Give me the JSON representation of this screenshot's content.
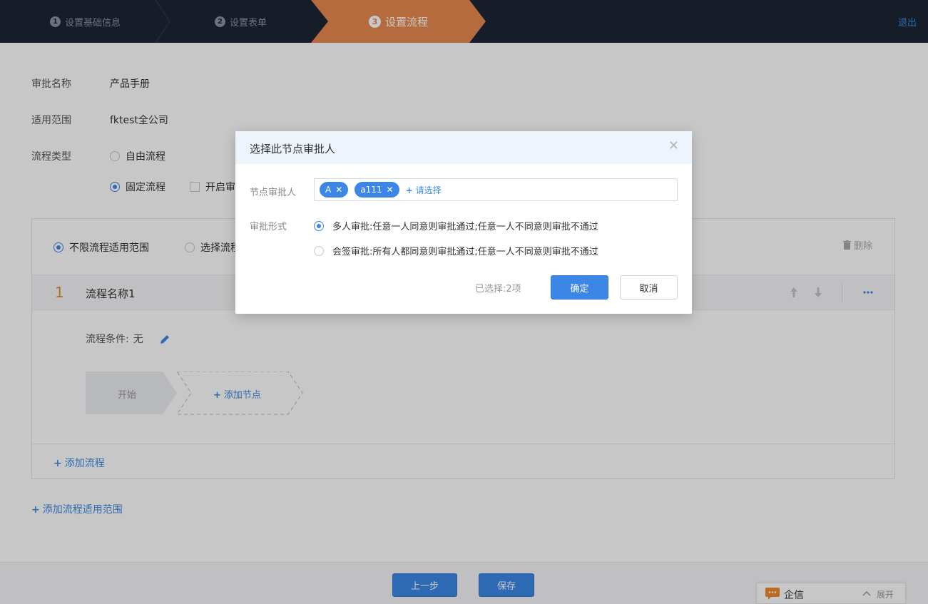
{
  "steps": [
    {
      "num": "1",
      "label": "设置基础信息"
    },
    {
      "num": "2",
      "label": "设置表单"
    },
    {
      "num": "3",
      "label": "设置流程"
    }
  ],
  "header": {
    "logout": "退出"
  },
  "form": {
    "name_label": "审批名称",
    "name_value": "产品手册",
    "scope_label": "适用范围",
    "scope_value": "fktest全公司",
    "type_label": "流程类型",
    "free_flow": "自由流程",
    "fixed_flow": "固定流程",
    "open_check": "开启审"
  },
  "panel": {
    "unlimited_scope": "不限流程适用范围",
    "select_scope": "选择流程",
    "delete": "删除",
    "flow_no": "1",
    "flow_name": "流程名称1",
    "condition_label": "流程条件:",
    "condition_value": "无",
    "start_node": "开始",
    "add_node": "添加节点",
    "add_flow": "添加流程"
  },
  "add_scope": "添加流程适用范围",
  "footer": {
    "prev": "上一步",
    "save": "保存"
  },
  "qixin": {
    "label": "企信",
    "expand": "展开"
  },
  "modal": {
    "title": "选择此节点审批人",
    "approver_label": "节点审批人",
    "tags": [
      "A",
      "a111"
    ],
    "add_select": "请选择",
    "mode_label": "审批形式",
    "mode_multi": "多人审批:任意一人同意则审批通过;任意一人不同意则审批不通过",
    "mode_joint": "会签审批:所有人都同意则审批通过;任意一人不同意则审批不通过",
    "selected": "已选择:2项",
    "confirm": "确定",
    "cancel": "取消"
  }
}
